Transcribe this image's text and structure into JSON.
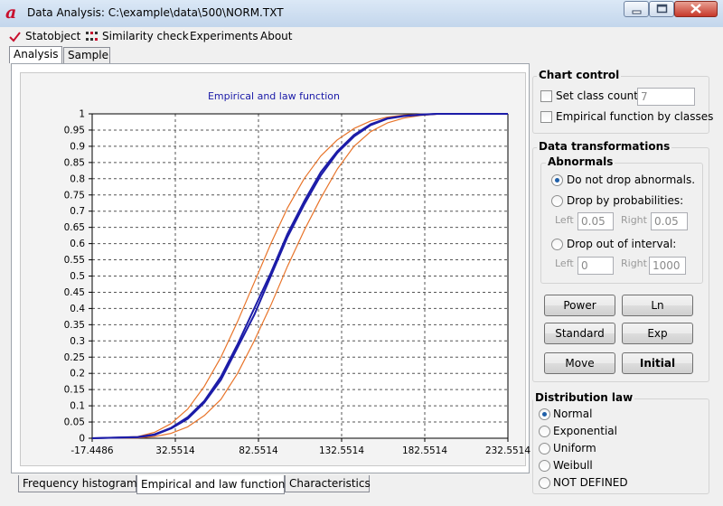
{
  "window": {
    "title": "Data Analysis: C:\\example\\data\\500\\NORM.TXT",
    "accent": "#c8102e"
  },
  "menu": [
    {
      "label": "Statobject",
      "icon": "check-mark-icon"
    },
    {
      "label": "Similarity check",
      "icon": "grid-icon"
    },
    {
      "label": "Experiments"
    },
    {
      "label": "About"
    }
  ],
  "top_tabs": [
    {
      "label": "Analysis",
      "active": true
    },
    {
      "label": "Sample",
      "active": false
    }
  ],
  "bottom_tabs": [
    {
      "label": "Frequency histogram",
      "active": false
    },
    {
      "label": "Empirical and law function",
      "active": true
    },
    {
      "label": "Characteristics",
      "active": false
    }
  ],
  "chart_control": {
    "title": "Chart control",
    "set_class_count_label": "Set class count",
    "class_count_value": "7",
    "empirical_by_classes_label": "Empirical function by classes"
  },
  "data_transformations": {
    "title": "Data transformations",
    "abnormals_title": "Abnormals",
    "options": [
      {
        "label": "Do not drop abnormals.",
        "checked": true
      },
      {
        "label": "Drop by probabilities:",
        "checked": false
      },
      {
        "label": "Drop out of interval:",
        "checked": false
      }
    ],
    "prob_left_label": "Left",
    "prob_left_value": "0.05",
    "prob_right_label": "Right",
    "prob_right_value": "0.05",
    "int_left_label": "Left",
    "int_left_value": "0",
    "int_right_label": "Right",
    "int_right_value": "1000",
    "buttons": [
      "Power",
      "Ln",
      "Standard",
      "Exp",
      "Move",
      "Initial"
    ]
  },
  "distribution_law": {
    "title": "Distribution law",
    "options": [
      {
        "label": "Normal",
        "checked": true
      },
      {
        "label": "Exponential",
        "checked": false
      },
      {
        "label": "Uniform",
        "checked": false
      },
      {
        "label": "Weibull",
        "checked": false
      },
      {
        "label": "NOT DEFINED",
        "checked": false
      }
    ]
  },
  "chart_data": {
    "type": "line",
    "title": "Empirical and law function",
    "xlabel": "",
    "ylabel": "",
    "x_ticks": [
      "-17.4486",
      "32.5514",
      "82.5514",
      "132.5514",
      "182.5514",
      "232.5514"
    ],
    "x_tick_values": [
      -17.4486,
      32.5514,
      82.5514,
      132.5514,
      182.5514,
      232.5514
    ],
    "y_ticks": [
      "0",
      "0.05",
      "0.1",
      "0.15",
      "0.2",
      "0.25",
      "0.3",
      "0.35",
      "0.4",
      "0.45",
      "0.5",
      "0.55",
      "0.6",
      "0.65",
      "0.7",
      "0.75",
      "0.8",
      "0.85",
      "0.9",
      "0.95",
      "1"
    ],
    "xlim": [
      -17.4486,
      232.5514
    ],
    "ylim": [
      0,
      1
    ],
    "grid": true,
    "series": [
      {
        "color": "#1c1ca8",
        "x": [
          -17.45,
          10,
          20,
          30,
          40,
          50,
          60,
          70,
          80,
          90,
          100,
          110,
          120,
          130,
          140,
          150,
          160,
          170,
          180,
          190,
          200,
          232.55
        ],
        "y": [
          0,
          0.003,
          0.01,
          0.03,
          0.06,
          0.11,
          0.18,
          0.28,
          0.38,
          0.5,
          0.62,
          0.72,
          0.81,
          0.88,
          0.93,
          0.965,
          0.985,
          0.993,
          0.997,
          1,
          1,
          1
        ]
      },
      {
        "color": "#1c1ca8",
        "x": [
          -17.45,
          10,
          20,
          30,
          40,
          50,
          60,
          70,
          80,
          90,
          100,
          110,
          120,
          130,
          140,
          150,
          160,
          170,
          180,
          190,
          200,
          232.55
        ],
        "y": [
          0,
          0.004,
          0.012,
          0.032,
          0.065,
          0.115,
          0.19,
          0.29,
          0.4,
          0.51,
          0.63,
          0.73,
          0.82,
          0.885,
          0.935,
          0.968,
          0.986,
          0.994,
          0.998,
          1,
          1,
          1
        ]
      },
      {
        "color": "#e8742a",
        "x": [
          -17.45,
          10,
          20,
          30,
          40,
          50,
          60,
          70,
          80,
          90,
          100,
          110,
          120,
          130,
          140,
          150,
          160,
          170,
          180,
          190,
          200,
          232.55
        ],
        "y": [
          0,
          0.005,
          0.018,
          0.045,
          0.09,
          0.16,
          0.25,
          0.36,
          0.48,
          0.6,
          0.71,
          0.8,
          0.87,
          0.92,
          0.955,
          0.978,
          0.99,
          0.996,
          0.999,
          1,
          1,
          1
        ]
      },
      {
        "color": "#e8742a",
        "x": [
          -17.45,
          10,
          20,
          30,
          40,
          50,
          60,
          70,
          80,
          90,
          100,
          110,
          120,
          130,
          140,
          150,
          160,
          170,
          180,
          190,
          200,
          232.55
        ],
        "y": [
          0,
          0.001,
          0.005,
          0.015,
          0.035,
          0.07,
          0.12,
          0.2,
          0.3,
          0.41,
          0.53,
          0.64,
          0.74,
          0.83,
          0.9,
          0.945,
          0.972,
          0.987,
          0.995,
          0.999,
          1,
          1
        ]
      }
    ]
  }
}
